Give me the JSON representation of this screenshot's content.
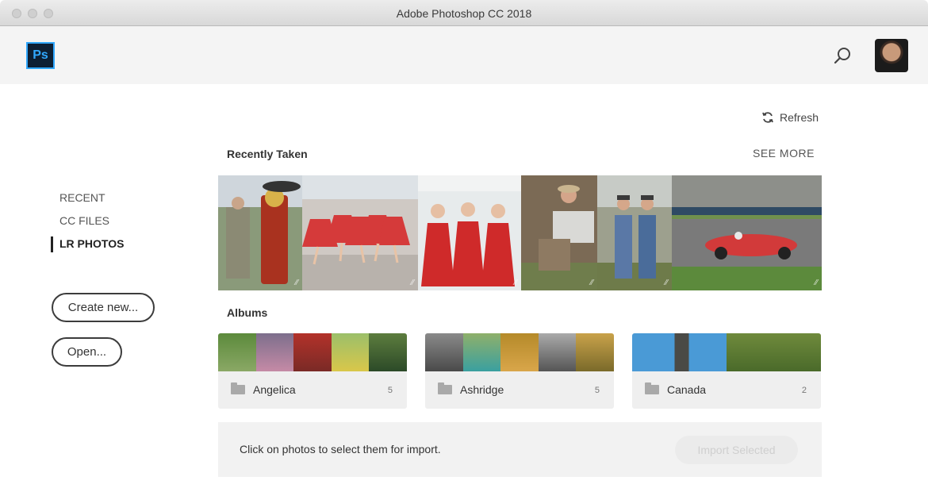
{
  "window": {
    "title": "Adobe Photoshop CC 2018"
  },
  "header": {
    "logo_text": "Ps",
    "search_icon": "search-icon",
    "avatar": "user-avatar"
  },
  "toolbar": {
    "refresh_label": "Refresh",
    "refresh_icon": "refresh-icon"
  },
  "sidebar": {
    "items": [
      {
        "label": "RECENT",
        "active": false
      },
      {
        "label": "CC FILES",
        "active": false
      },
      {
        "label": "LR PHOTOS",
        "active": true
      }
    ],
    "create_new_label": "Create new...",
    "open_label": "Open..."
  },
  "recent": {
    "title": "Recently Taken",
    "see_more_label": "SEE MORE",
    "photos": [
      {
        "id": "vintage-fuel-pump"
      },
      {
        "id": "red-dancers-line"
      },
      {
        "id": "three-women-red-dresses"
      },
      {
        "id": "accordion-player"
      },
      {
        "id": "men-in-overalls"
      },
      {
        "id": "red-race-car"
      }
    ]
  },
  "albums": {
    "title": "Albums",
    "items": [
      {
        "name": "Angelica",
        "count": "5"
      },
      {
        "name": "Ashridge",
        "count": "5"
      },
      {
        "name": "Canada",
        "count": "2"
      }
    ]
  },
  "import": {
    "message": "Click on photos to select them for import.",
    "button_label": "Import Selected"
  },
  "colors": {
    "accent": "#31a8ff",
    "logo_bg": "#0d1f33",
    "header_bg": "#f4f4f4"
  }
}
